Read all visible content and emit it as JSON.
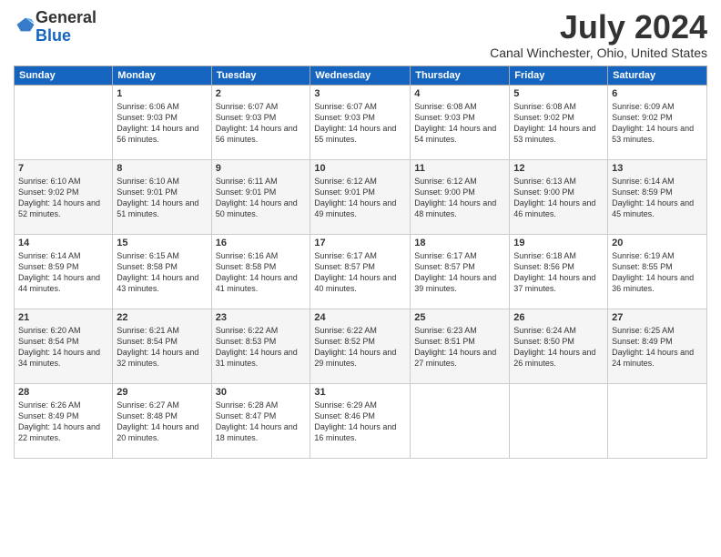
{
  "header": {
    "logo_general": "General",
    "logo_blue": "Blue",
    "month": "July 2024",
    "location": "Canal Winchester, Ohio, United States"
  },
  "days": [
    "Sunday",
    "Monday",
    "Tuesday",
    "Wednesday",
    "Thursday",
    "Friday",
    "Saturday"
  ],
  "weeks": [
    [
      {
        "date": "",
        "sunrise": "",
        "sunset": "",
        "daylight": ""
      },
      {
        "date": "1",
        "sunrise": "Sunrise: 6:06 AM",
        "sunset": "Sunset: 9:03 PM",
        "daylight": "Daylight: 14 hours and 56 minutes."
      },
      {
        "date": "2",
        "sunrise": "Sunrise: 6:07 AM",
        "sunset": "Sunset: 9:03 PM",
        "daylight": "Daylight: 14 hours and 56 minutes."
      },
      {
        "date": "3",
        "sunrise": "Sunrise: 6:07 AM",
        "sunset": "Sunset: 9:03 PM",
        "daylight": "Daylight: 14 hours and 55 minutes."
      },
      {
        "date": "4",
        "sunrise": "Sunrise: 6:08 AM",
        "sunset": "Sunset: 9:03 PM",
        "daylight": "Daylight: 14 hours and 54 minutes."
      },
      {
        "date": "5",
        "sunrise": "Sunrise: 6:08 AM",
        "sunset": "Sunset: 9:02 PM",
        "daylight": "Daylight: 14 hours and 53 minutes."
      },
      {
        "date": "6",
        "sunrise": "Sunrise: 6:09 AM",
        "sunset": "Sunset: 9:02 PM",
        "daylight": "Daylight: 14 hours and 53 minutes."
      }
    ],
    [
      {
        "date": "7",
        "sunrise": "Sunrise: 6:10 AM",
        "sunset": "Sunset: 9:02 PM",
        "daylight": "Daylight: 14 hours and 52 minutes."
      },
      {
        "date": "8",
        "sunrise": "Sunrise: 6:10 AM",
        "sunset": "Sunset: 9:01 PM",
        "daylight": "Daylight: 14 hours and 51 minutes."
      },
      {
        "date": "9",
        "sunrise": "Sunrise: 6:11 AM",
        "sunset": "Sunset: 9:01 PM",
        "daylight": "Daylight: 14 hours and 50 minutes."
      },
      {
        "date": "10",
        "sunrise": "Sunrise: 6:12 AM",
        "sunset": "Sunset: 9:01 PM",
        "daylight": "Daylight: 14 hours and 49 minutes."
      },
      {
        "date": "11",
        "sunrise": "Sunrise: 6:12 AM",
        "sunset": "Sunset: 9:00 PM",
        "daylight": "Daylight: 14 hours and 48 minutes."
      },
      {
        "date": "12",
        "sunrise": "Sunrise: 6:13 AM",
        "sunset": "Sunset: 9:00 PM",
        "daylight": "Daylight: 14 hours and 46 minutes."
      },
      {
        "date": "13",
        "sunrise": "Sunrise: 6:14 AM",
        "sunset": "Sunset: 8:59 PM",
        "daylight": "Daylight: 14 hours and 45 minutes."
      }
    ],
    [
      {
        "date": "14",
        "sunrise": "Sunrise: 6:14 AM",
        "sunset": "Sunset: 8:59 PM",
        "daylight": "Daylight: 14 hours and 44 minutes."
      },
      {
        "date": "15",
        "sunrise": "Sunrise: 6:15 AM",
        "sunset": "Sunset: 8:58 PM",
        "daylight": "Daylight: 14 hours and 43 minutes."
      },
      {
        "date": "16",
        "sunrise": "Sunrise: 6:16 AM",
        "sunset": "Sunset: 8:58 PM",
        "daylight": "Daylight: 14 hours and 41 minutes."
      },
      {
        "date": "17",
        "sunrise": "Sunrise: 6:17 AM",
        "sunset": "Sunset: 8:57 PM",
        "daylight": "Daylight: 14 hours and 40 minutes."
      },
      {
        "date": "18",
        "sunrise": "Sunrise: 6:17 AM",
        "sunset": "Sunset: 8:57 PM",
        "daylight": "Daylight: 14 hours and 39 minutes."
      },
      {
        "date": "19",
        "sunrise": "Sunrise: 6:18 AM",
        "sunset": "Sunset: 8:56 PM",
        "daylight": "Daylight: 14 hours and 37 minutes."
      },
      {
        "date": "20",
        "sunrise": "Sunrise: 6:19 AM",
        "sunset": "Sunset: 8:55 PM",
        "daylight": "Daylight: 14 hours and 36 minutes."
      }
    ],
    [
      {
        "date": "21",
        "sunrise": "Sunrise: 6:20 AM",
        "sunset": "Sunset: 8:54 PM",
        "daylight": "Daylight: 14 hours and 34 minutes."
      },
      {
        "date": "22",
        "sunrise": "Sunrise: 6:21 AM",
        "sunset": "Sunset: 8:54 PM",
        "daylight": "Daylight: 14 hours and 32 minutes."
      },
      {
        "date": "23",
        "sunrise": "Sunrise: 6:22 AM",
        "sunset": "Sunset: 8:53 PM",
        "daylight": "Daylight: 14 hours and 31 minutes."
      },
      {
        "date": "24",
        "sunrise": "Sunrise: 6:22 AM",
        "sunset": "Sunset: 8:52 PM",
        "daylight": "Daylight: 14 hours and 29 minutes."
      },
      {
        "date": "25",
        "sunrise": "Sunrise: 6:23 AM",
        "sunset": "Sunset: 8:51 PM",
        "daylight": "Daylight: 14 hours and 27 minutes."
      },
      {
        "date": "26",
        "sunrise": "Sunrise: 6:24 AM",
        "sunset": "Sunset: 8:50 PM",
        "daylight": "Daylight: 14 hours and 26 minutes."
      },
      {
        "date": "27",
        "sunrise": "Sunrise: 6:25 AM",
        "sunset": "Sunset: 8:49 PM",
        "daylight": "Daylight: 14 hours and 24 minutes."
      }
    ],
    [
      {
        "date": "28",
        "sunrise": "Sunrise: 6:26 AM",
        "sunset": "Sunset: 8:49 PM",
        "daylight": "Daylight: 14 hours and 22 minutes."
      },
      {
        "date": "29",
        "sunrise": "Sunrise: 6:27 AM",
        "sunset": "Sunset: 8:48 PM",
        "daylight": "Daylight: 14 hours and 20 minutes."
      },
      {
        "date": "30",
        "sunrise": "Sunrise: 6:28 AM",
        "sunset": "Sunset: 8:47 PM",
        "daylight": "Daylight: 14 hours and 18 minutes."
      },
      {
        "date": "31",
        "sunrise": "Sunrise: 6:29 AM",
        "sunset": "Sunset: 8:46 PM",
        "daylight": "Daylight: 14 hours and 16 minutes."
      },
      {
        "date": "",
        "sunrise": "",
        "sunset": "",
        "daylight": ""
      },
      {
        "date": "",
        "sunrise": "",
        "sunset": "",
        "daylight": ""
      },
      {
        "date": "",
        "sunrise": "",
        "sunset": "",
        "daylight": ""
      }
    ]
  ]
}
